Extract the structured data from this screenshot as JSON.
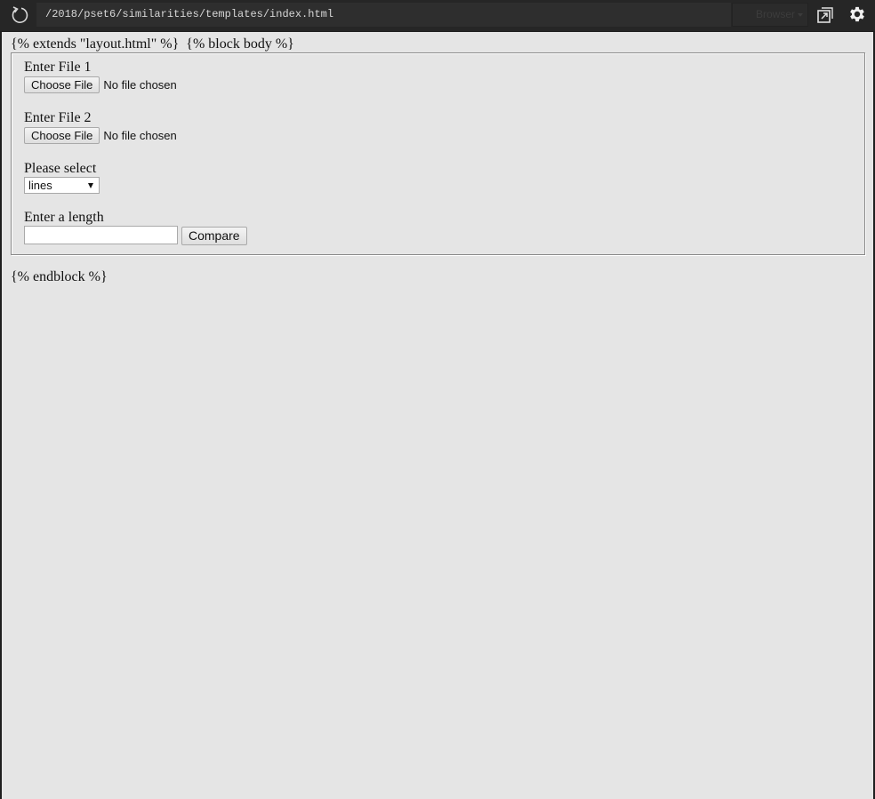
{
  "toolbar": {
    "reload_icon": "reload-icon",
    "url": "/2018/pset6/similarities/templates/index.html",
    "browser_label": "Browser",
    "popout_icon": "popout-icon",
    "settings_icon": "gear-icon"
  },
  "page": {
    "template_header": "{% extends \"layout.html\" %}  {% block body %}",
    "template_footer": "{% endblock %}",
    "form": {
      "file1_label": "Enter File 1",
      "file1_button": "Choose File",
      "file1_status": "No file chosen",
      "file2_label": "Enter File 2",
      "file2_button": "Choose File",
      "file2_status": "No file chosen",
      "select_label": "Please select",
      "select_value": "lines",
      "length_label": "Enter a length",
      "length_value": "",
      "compare_button": "Compare"
    }
  }
}
